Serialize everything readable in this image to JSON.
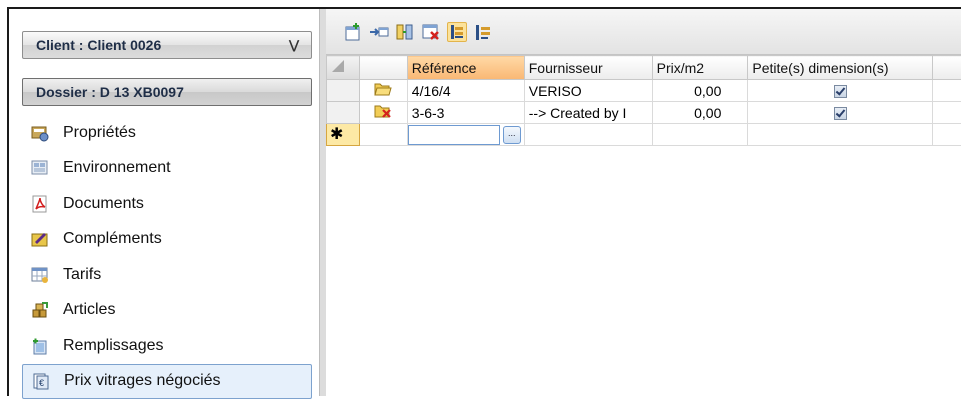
{
  "sidebar": {
    "client_header": "Client : Client 0026",
    "dossier_header": "Dossier : D 13 XB0097",
    "collapse_glyph": "¥",
    "items": [
      {
        "label": "Propriétés",
        "icon": "properties-icon"
      },
      {
        "label": "Environnement",
        "icon": "environment-icon"
      },
      {
        "label": "Documents",
        "icon": "pdf-document-icon"
      },
      {
        "label": "Compléments",
        "icon": "complements-icon"
      },
      {
        "label": "Tarifs",
        "icon": "tariffs-icon"
      },
      {
        "label": "Articles",
        "icon": "articles-icon"
      },
      {
        "label": "Remplissages",
        "icon": "fillings-icon"
      },
      {
        "label": "Prix vitrages négociés",
        "icon": "negotiated-glazing-price-icon",
        "selected": true
      }
    ]
  },
  "toolbar": {
    "buttons": [
      "add-row-icon",
      "insert-icon",
      "columns-icon",
      "delete-icon",
      "filter-icon",
      "sort-icon"
    ]
  },
  "grid": {
    "columns": [
      "Référence",
      "Fournisseur",
      "Prix/m2",
      "Petite(s) dimension(s)"
    ],
    "rows": [
      {
        "reference": "4/16/4",
        "fournisseur": "VERISO",
        "prix": "0,00",
        "petite": true
      },
      {
        "reference": "3-6-3",
        "fournisseur": "--> Created by I",
        "prix": "0,00",
        "petite": true
      }
    ],
    "new_row_marker": "✱",
    "ellipsis": "..."
  },
  "colors": {
    "sort_header": "#f9b774",
    "selection_border": "#7da2ce",
    "new_row": "#fde9a5"
  }
}
